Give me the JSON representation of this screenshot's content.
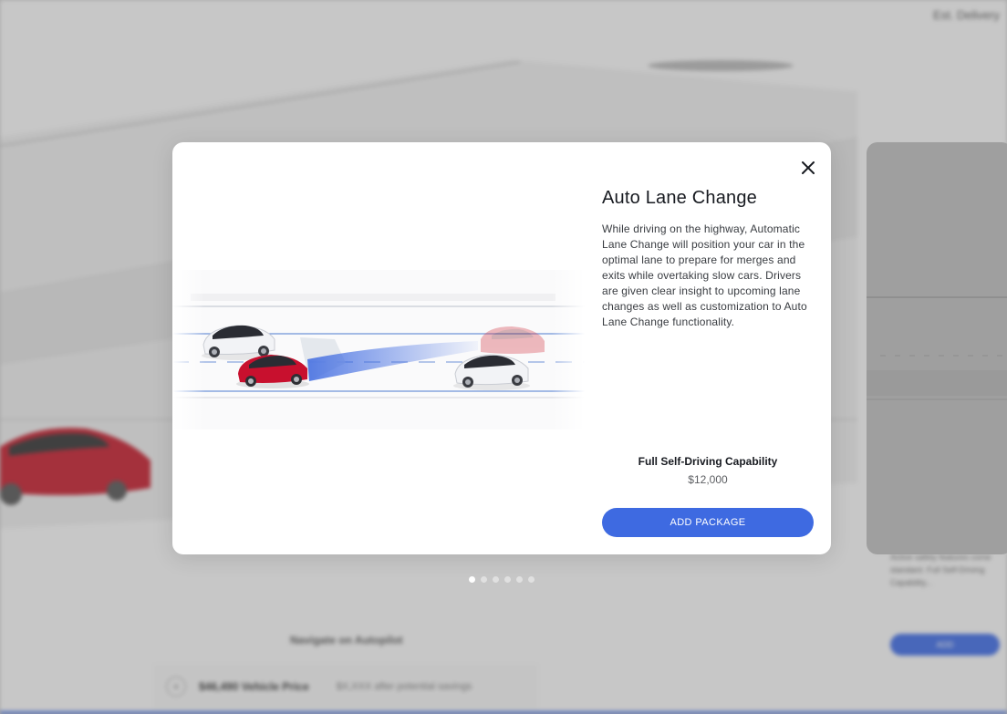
{
  "background": {
    "delivery_label": "Est. Delivery",
    "nav_label": "Navigate on Autopilot",
    "price_bar": {
      "plus_icon": "plus-icon",
      "vehicle_price": "$46,490 Vehicle Price",
      "savings_note": "$X,XXX after potential savings"
    },
    "side_text": "Active safety features come standard. Full Self-Driving Capability...",
    "side_button": "ADD"
  },
  "modal": {
    "title": "Auto Lane Change",
    "description": "While driving on the highway, Automatic Lane Change will position your car in the optimal lane to prepare for merges and exits while overtaking slow cars. Drivers are given clear insight to upcoming lane changes as well as customization to Auto Lane Change functionality.",
    "package_name": "Full Self-Driving Capability",
    "package_price": "$12,000",
    "add_button": "ADD PACKAGE",
    "close_icon": "close-icon"
  },
  "pagination": {
    "count": 6,
    "active_index": 0
  },
  "colors": {
    "accent": "#3e6ae1",
    "title": "#171a20",
    "body_text": "#393c41",
    "car_red": "#c8102e"
  }
}
